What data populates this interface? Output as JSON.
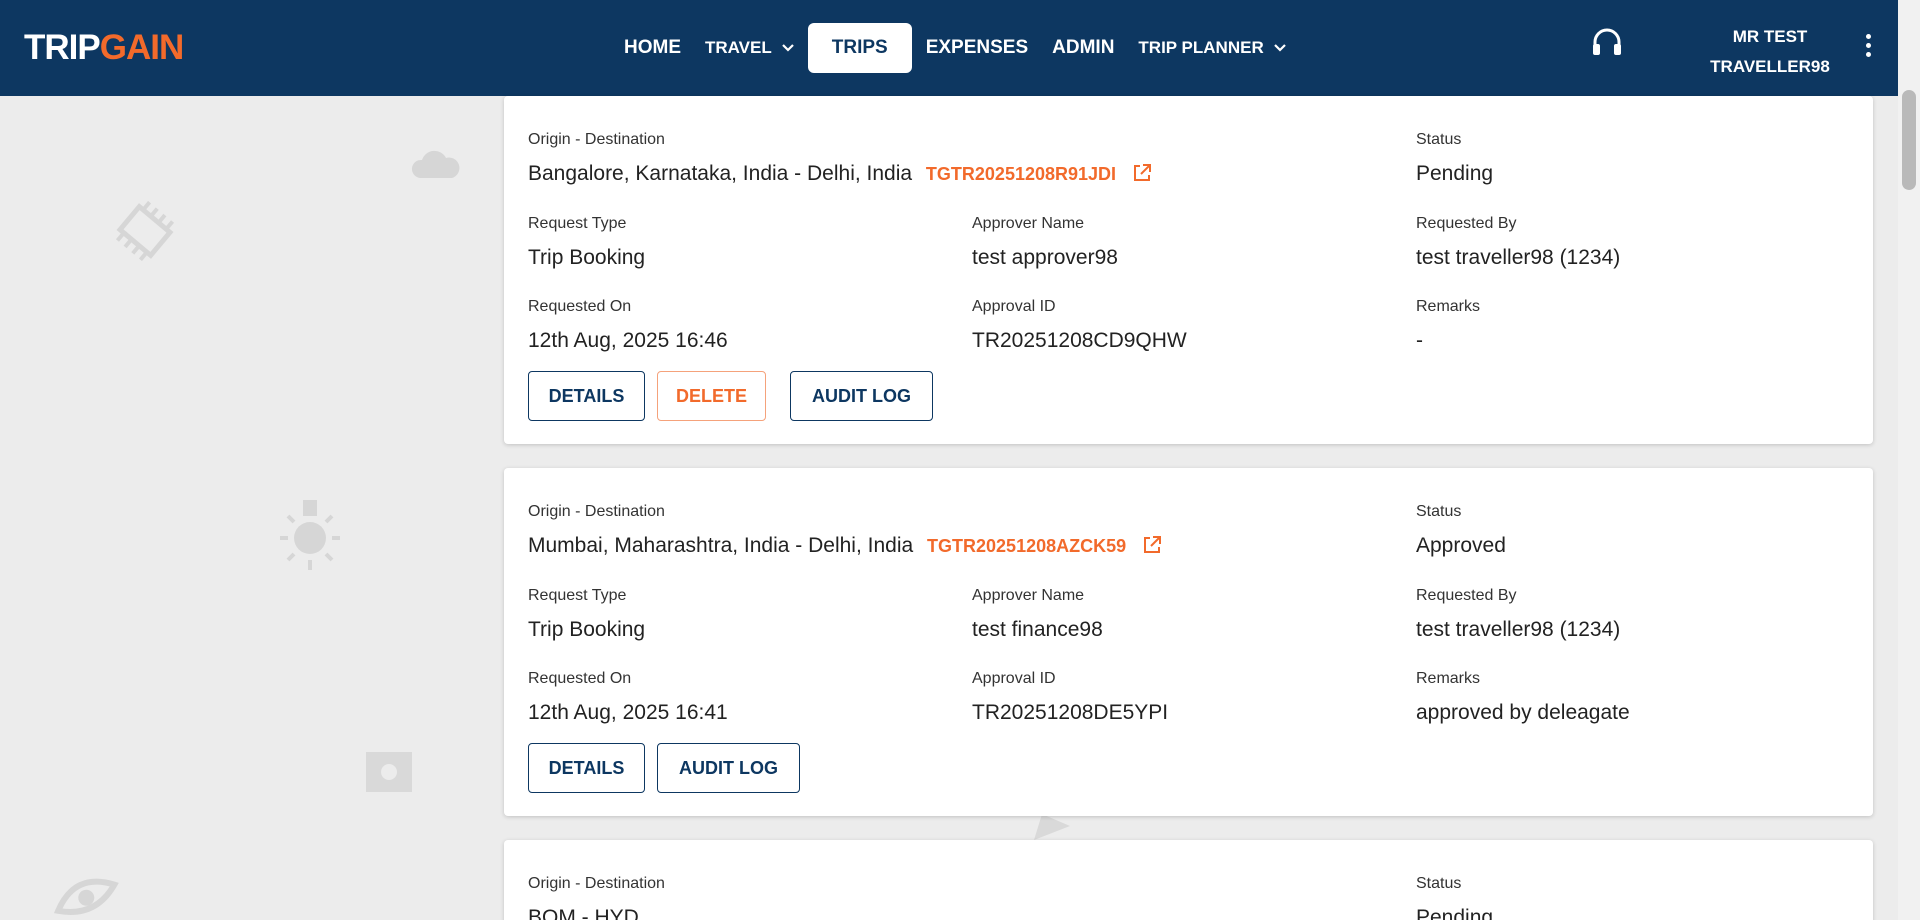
{
  "header": {
    "logo_trip": "TRIP",
    "logo_gain": "GAIN",
    "nav": [
      {
        "label": "HOME"
      },
      {
        "label": "TRAVEL"
      },
      {
        "label": "TRIPS"
      },
      {
        "label": "EXPENSES"
      },
      {
        "label": "ADMIN"
      },
      {
        "label": "TRIP PLANNER"
      }
    ],
    "user_line1": "MR TEST",
    "user_line2": "TRAVELLER98"
  },
  "labels": {
    "origin_destination": "Origin - Destination",
    "status": "Status",
    "request_type": "Request Type",
    "approver_name": "Approver Name",
    "requested_by": "Requested By",
    "requested_on": "Requested On",
    "approval_id": "Approval ID",
    "remarks": "Remarks"
  },
  "buttons": {
    "details": "DETAILS",
    "delete": "DELETE",
    "audit_log": "AUDIT LOG"
  },
  "trips": [
    {
      "route": "Bangalore, Karnataka, India - Delhi, India",
      "trip_id": "TGTR20251208R91JDI",
      "status": "Pending",
      "request_type": "Trip Booking",
      "approver_name": "test approver98",
      "requested_by": "test traveller98 (1234)",
      "requested_on": "12th Aug, 2025 16:46",
      "approval_id": "TR20251208CD9QHW",
      "remarks": "-"
    },
    {
      "route": "Mumbai, Maharashtra, India - Delhi, India",
      "trip_id": "TGTR20251208AZCK59",
      "status": "Approved",
      "request_type": "Trip Booking",
      "approver_name": "test finance98",
      "requested_by": "test traveller98 (1234)",
      "requested_on": "12th Aug, 2025 16:41",
      "approval_id": "TR20251208DE5YPI",
      "remarks": "approved by deleagate"
    },
    {
      "route": "BOM - HYD",
      "status": "Pending"
    }
  ],
  "colors": {
    "header_bg": "#0d3761",
    "accent": "#f26a2b",
    "page_bg": "#ececec"
  }
}
